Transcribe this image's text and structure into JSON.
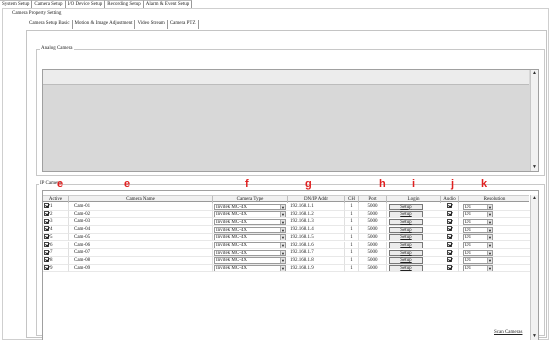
{
  "main_tabs": [
    "System Setup",
    "Camera Setup",
    "I/O Device Setup",
    "Recording Setup",
    "Alarm & Event Setup"
  ],
  "active_main_tab": "Camera Setup",
  "property_section_label": "Camera Property Setting",
  "sub_tabs": [
    "Camera Setup Basic",
    "Motion & Image Adjustment",
    "Video Stream",
    "Camera PTZ"
  ],
  "active_sub_tab": "Camera Setup Basic",
  "analog_group_label": "Analog Camera",
  "ip_group_label": "IP Camera",
  "columns": {
    "active": "Active",
    "name": "Camera Name",
    "type": "Camera Type",
    "addr": "DN/IP Addr",
    "ch": "CH",
    "port": "Port",
    "login": "Login",
    "audio": "Audio",
    "resolution": "Resolution"
  },
  "markers": {
    "active": "e",
    "name": "e",
    "type": "f",
    "addr": "g",
    "port": "h",
    "login": "i",
    "audio": "j",
    "resolution": "k"
  },
  "marker_color": "#e02020",
  "rows": [
    {
      "num": "1",
      "active": true,
      "name": "Cam-01",
      "type": "Invitek MC-4X",
      "addr": "192.168.1.1",
      "ch": "1",
      "port": "5000",
      "login": "Setup",
      "audio": true,
      "resolution": "D1"
    },
    {
      "num": "2",
      "active": true,
      "name": "Cam-02",
      "type": "Invitek MC-4X",
      "addr": "192.168.1.2",
      "ch": "1",
      "port": "5000",
      "login": "Setup",
      "audio": true,
      "resolution": "D1"
    },
    {
      "num": "3",
      "active": true,
      "name": "Cam-03",
      "type": "Invitek MC-4X",
      "addr": "192.168.1.3",
      "ch": "1",
      "port": "5000",
      "login": "Setup",
      "audio": true,
      "resolution": "D1"
    },
    {
      "num": "4",
      "active": true,
      "name": "Cam-04",
      "type": "Invitek MC-4X",
      "addr": "192.168.1.4",
      "ch": "1",
      "port": "5000",
      "login": "Setup",
      "audio": true,
      "resolution": "D1"
    },
    {
      "num": "5",
      "active": true,
      "name": "Cam-05",
      "type": "Invitek MC-4X",
      "addr": "192.168.1.5",
      "ch": "1",
      "port": "5000",
      "login": "Setup",
      "audio": true,
      "resolution": "D1"
    },
    {
      "num": "6",
      "active": true,
      "name": "Cam-06",
      "type": "Invitek MC-4X",
      "addr": "192.168.1.6",
      "ch": "1",
      "port": "5000",
      "login": "Setup",
      "audio": true,
      "resolution": "D1"
    },
    {
      "num": "7",
      "active": true,
      "name": "Cam-07",
      "type": "Invitek MC-4X",
      "addr": "192.168.1.7",
      "ch": "1",
      "port": "5000",
      "login": "Setup",
      "audio": true,
      "resolution": "D1"
    },
    {
      "num": "8",
      "active": true,
      "name": "Cam-08",
      "type": "Invitek MC-4X",
      "addr": "192.168.1.8",
      "ch": "1",
      "port": "5000",
      "login": "Setup",
      "audio": true,
      "resolution": "D1"
    },
    {
      "num": "9",
      "active": true,
      "name": "Cam-09",
      "type": "Invitek MC-4X",
      "addr": "192.168.1.9",
      "ch": "1",
      "port": "5000",
      "login": "Setup",
      "audio": true,
      "resolution": "D1"
    }
  ],
  "scan_button_label": "Scan Cameras",
  "scroll_up_icon": "▲",
  "scroll_down_icon": "▼",
  "dropdown_icon": "▼"
}
